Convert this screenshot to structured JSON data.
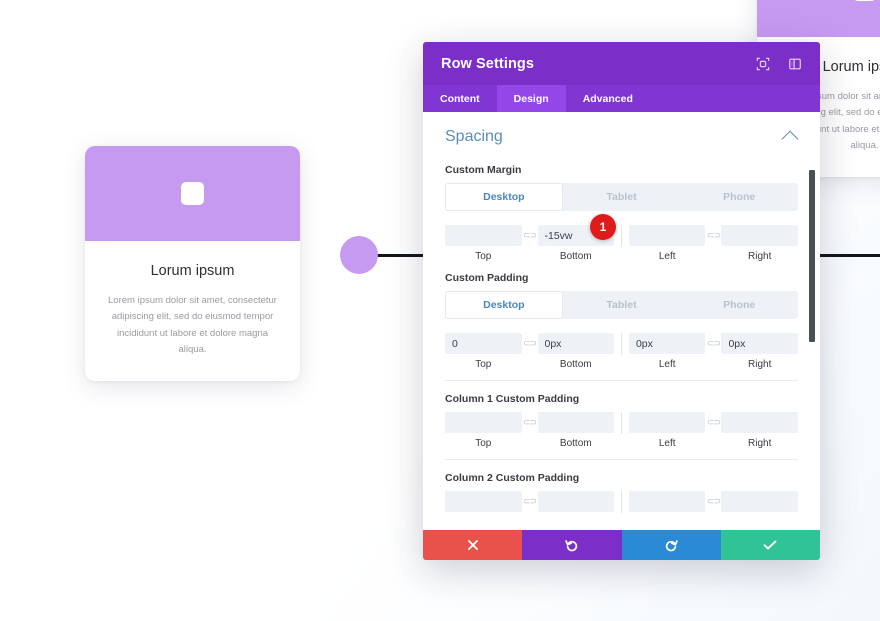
{
  "background": {
    "accent_purple": "#7b2ec8",
    "card_purple": "#c79af2"
  },
  "left_card": {
    "name": "feature-card",
    "icon": "rounded-square-icon",
    "title": "Lorum ipsum",
    "body": "Lorem ipsum dolor sit amet, consectetur adipiscing elit, sed do eiusmod tempor incididunt ut labore et dolore magna aliqua."
  },
  "right_card": {
    "name": "feature-card-clipped",
    "icon": "rounded-square-icon",
    "title": "Lorum ipsum",
    "body": "Lorem ipsum dolor sit amet, consectetur adipiscing elit, sed do eiusmod tempor incididunt ut labore et dolore magna aliqua."
  },
  "modal": {
    "title": "Row Settings",
    "header_icons": [
      {
        "name": "focus-target-icon"
      },
      {
        "name": "panel-layout-icon"
      }
    ],
    "tabs": [
      {
        "label": "Content",
        "active": false
      },
      {
        "label": "Design",
        "active": true
      },
      {
        "label": "Advanced",
        "active": false
      }
    ],
    "section": {
      "title": "Spacing",
      "collapse_icon": "chevron-up-icon"
    },
    "groups": [
      {
        "label": "Custom Margin",
        "devices": [
          {
            "label": "Desktop",
            "active": true
          },
          {
            "label": "Tablet",
            "active": false
          },
          {
            "label": "Phone",
            "active": false
          }
        ],
        "fields": [
          {
            "caption": "Top",
            "value": "",
            "placeholder": ""
          },
          {
            "caption": "Bottom",
            "value": "-15vw",
            "placeholder": ""
          },
          {
            "caption": "Left",
            "value": "",
            "placeholder": ""
          },
          {
            "caption": "Right",
            "value": "",
            "placeholder": ""
          }
        ]
      },
      {
        "label": "Custom Padding",
        "devices": [
          {
            "label": "Desktop",
            "active": true
          },
          {
            "label": "Tablet",
            "active": false
          },
          {
            "label": "Phone",
            "active": false
          }
        ],
        "fields": [
          {
            "caption": "Top",
            "value": "0",
            "placeholder": ""
          },
          {
            "caption": "Bottom",
            "value": "0px",
            "placeholder": ""
          },
          {
            "caption": "Left",
            "value": "0px",
            "placeholder": ""
          },
          {
            "caption": "Right",
            "value": "0px",
            "placeholder": ""
          }
        ]
      },
      {
        "label": "Column 1 Custom Padding",
        "devices": null,
        "fields": [
          {
            "caption": "Top",
            "value": "",
            "placeholder": ""
          },
          {
            "caption": "Bottom",
            "value": "",
            "placeholder": ""
          },
          {
            "caption": "Left",
            "value": "",
            "placeholder": ""
          },
          {
            "caption": "Right",
            "value": "",
            "placeholder": ""
          }
        ]
      },
      {
        "label": "Column 2 Custom Padding",
        "devices": null,
        "fields": [
          {
            "caption": "",
            "value": "",
            "placeholder": ""
          },
          {
            "caption": "",
            "value": "",
            "placeholder": ""
          },
          {
            "caption": "",
            "value": "",
            "placeholder": ""
          },
          {
            "caption": "",
            "value": "",
            "placeholder": ""
          }
        ]
      }
    ],
    "footer": [
      {
        "name": "cancel-button",
        "icon": "close-icon",
        "color": "#e8524b"
      },
      {
        "name": "undo-button",
        "icon": "undo-icon",
        "color": "#7b2ec8"
      },
      {
        "name": "redo-button",
        "icon": "redo-icon",
        "color": "#2b8ad6"
      },
      {
        "name": "save-button",
        "icon": "check-icon",
        "color": "#30c396"
      }
    ]
  },
  "annotation": {
    "badge_number": "1",
    "badge_color": "#e01b1b"
  },
  "link_icon_glyph": "⊂⊃"
}
